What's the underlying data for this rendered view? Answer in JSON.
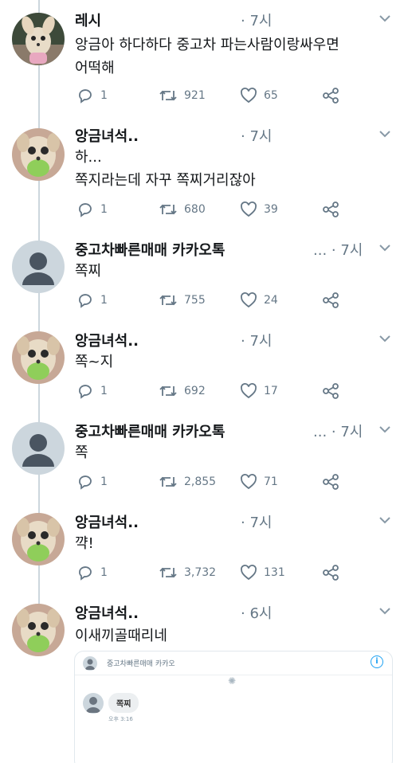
{
  "tweets": [
    {
      "name": "레시",
      "time": "· 7시",
      "lines": [
        "앙금아 하다하다 중고차 파는사람이랑싸우면",
        "어떡해"
      ],
      "replies": "1",
      "retweets": "921",
      "likes": "65",
      "avatar": "chihuahua-photo"
    },
    {
      "name": "앙금녀석..",
      "time": "· 7시",
      "lines": [
        "하...",
        "쪽지라는데 자꾸 쪽찌거리잖아"
      ],
      "replies": "1",
      "retweets": "680",
      "likes": "39",
      "avatar": "chihuahua-closeup"
    },
    {
      "name": "중고차빠른매매 카카오톡",
      "time": "... · 7시",
      "lines": [
        "쪽찌"
      ],
      "replies": "1",
      "retweets": "755",
      "likes": "24",
      "avatar": "default-profile"
    },
    {
      "name": "앙금녀석..",
      "time": "· 7시",
      "lines": [
        "쪽~지"
      ],
      "replies": "1",
      "retweets": "692",
      "likes": "17",
      "avatar": "chihuahua-closeup"
    },
    {
      "name": "중고차빠른매매 카카오톡",
      "time": "... · 7시",
      "lines": [
        "쪽"
      ],
      "replies": "1",
      "retweets": "2,855",
      "likes": "71",
      "avatar": "default-profile"
    },
    {
      "name": "앙금녀석..",
      "time": "· 7시",
      "lines": [
        "꺅!"
      ],
      "replies": "1",
      "retweets": "3,732",
      "likes": "131",
      "avatar": "chihuahua-closeup"
    },
    {
      "name": "앙금녀석..",
      "time": "· 6시",
      "lines": [
        "이새끼골때리네"
      ],
      "avatar": "chihuahua-closeup"
    }
  ],
  "embed": {
    "title": "중고차빠른매매 카카오",
    "bubble": "쪽찌",
    "time": "오후 3:16",
    "info_icon": "i"
  },
  "icons": {
    "reply": "reply-icon",
    "retweet": "retweet-icon",
    "like": "heart-icon",
    "share": "share-icon",
    "more": "chevron-down-icon"
  },
  "colors": {
    "text": "#14171a",
    "muted": "#657786",
    "line": "#ccd6dd",
    "accent": "#1da1f2"
  }
}
